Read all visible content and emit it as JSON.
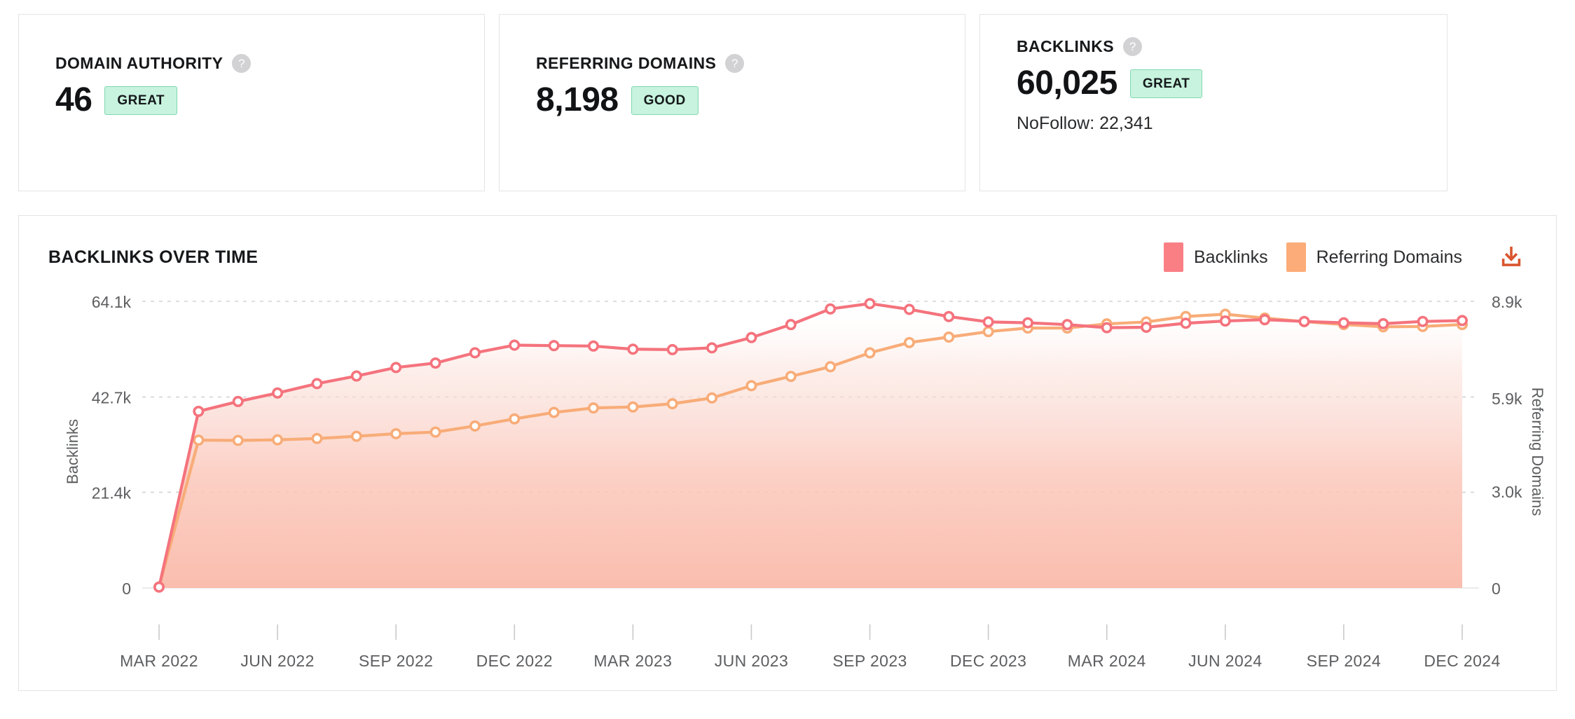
{
  "kpis": [
    {
      "title": "DOMAIN AUTHORITY",
      "value": "46",
      "badge": "GREAT",
      "help": "help-icon",
      "sub": ""
    },
    {
      "title": "REFERRING DOMAINS",
      "value": "8,198",
      "badge": "GOOD",
      "help": "help-icon",
      "sub": ""
    },
    {
      "title": "BACKLINKS",
      "value": "60,025",
      "badge": "GREAT",
      "help": "help-icon",
      "sub": "NoFollow: 22,341"
    }
  ],
  "chart_panel": {
    "title": "BACKLINKS OVER TIME",
    "download_label": "download-icon",
    "legend": [
      {
        "label": "Backlinks",
        "color": "#fa7f85"
      },
      {
        "label": "Referring Domains",
        "color": "#fcac78"
      }
    ]
  },
  "colors": {
    "backlinks": "#f4737d",
    "referring": "#f8ac78",
    "badge_bg": "#c8f3de",
    "badge_border": "#7fd9b0",
    "download": "#d9552e",
    "grid": "#cfcfcf",
    "axis_text": "#5d5e60",
    "card_border": "#e4e4e4"
  },
  "chart_data": {
    "type": "line",
    "title": "BACKLINKS OVER TIME",
    "xlabel": "",
    "ylabel": "Backlinks",
    "y2label": "Referring Domains",
    "grid": true,
    "legend_position": "top-right",
    "area_fill": true,
    "ylim": [
      0,
      64100
    ],
    "y2lim": [
      0,
      8900
    ],
    "yticks": [
      0,
      21400,
      42700,
      64100
    ],
    "ytick_labels": [
      "0",
      "21.4k",
      "42.7k",
      "64.1k"
    ],
    "y2ticks": [
      0,
      3000,
      5900,
      8900
    ],
    "y2tick_labels": [
      "0",
      "3.0k",
      "5.9k",
      "8.9k"
    ],
    "xtick_labels": [
      "MAR 2022",
      "JUN 2022",
      "SEP 2022",
      "DEC 2022",
      "MAR 2023",
      "JUN 2023",
      "SEP 2023",
      "DEC 2023",
      "MAR 2024",
      "JUN 2024",
      "SEP 2024",
      "DEC 2024"
    ],
    "xtick_indices": [
      0,
      3,
      6,
      9,
      12,
      15,
      18,
      21,
      24,
      27,
      30,
      33
    ],
    "x": [
      "MAR 2022",
      "APR 2022",
      "MAY 2022",
      "JUN 2022",
      "JUL 2022",
      "AUG 2022",
      "SEP 2022",
      "OCT 2022",
      "NOV 2022",
      "DEC 2022",
      "JAN 2023",
      "FEB 2023",
      "MAR 2023",
      "APR 2023",
      "MAY 2023",
      "JUN 2023",
      "JUL 2023",
      "AUG 2023",
      "SEP 2023",
      "OCT 2023",
      "NOV 2023",
      "DEC 2023",
      "JAN 2024",
      "FEB 2024",
      "MAR 2024",
      "APR 2024",
      "MAY 2024",
      "JUN 2024",
      "JUL 2024",
      "AUG 2024",
      "SEP 2024",
      "OCT 2024",
      "NOV 2024",
      "DEC 2024"
    ],
    "series": [
      {
        "name": "Backlinks",
        "axis": "left",
        "color": "#f4737d",
        "values": [
          200,
          39500,
          41700,
          43600,
          45700,
          47400,
          49300,
          50300,
          52600,
          54300,
          54200,
          54100,
          53400,
          53300,
          53700,
          56000,
          58900,
          62400,
          63600,
          62300,
          60700,
          59500,
          59300,
          58900,
          58200,
          58300,
          59200,
          59700,
          60000,
          59600,
          59300,
          59100,
          59600,
          59800
        ]
      },
      {
        "name": "Referring Domains",
        "axis": "right",
        "color": "#f8ac78",
        "values": [
          30,
          4590,
          4580,
          4600,
          4640,
          4710,
          4790,
          4840,
          5030,
          5250,
          5450,
          5590,
          5620,
          5720,
          5900,
          6280,
          6570,
          6870,
          7300,
          7620,
          7790,
          7960,
          8070,
          8070,
          8200,
          8260,
          8430,
          8500,
          8380,
          8270,
          8180,
          8110,
          8120,
          8180
        ]
      }
    ]
  }
}
